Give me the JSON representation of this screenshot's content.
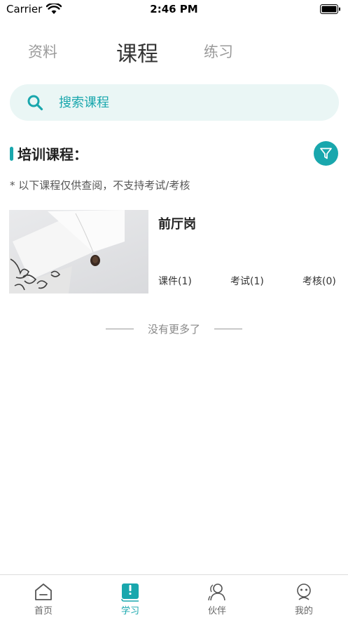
{
  "status_bar": {
    "carrier": "Carrier",
    "time": "2:46 PM"
  },
  "tabs": [
    {
      "label": "资料",
      "active": false
    },
    {
      "label": "课程",
      "active": true
    },
    {
      "label": "练习",
      "active": false
    }
  ],
  "search": {
    "placeholder": "搜索课程",
    "icon": "search-icon"
  },
  "section": {
    "title": "培训课程：",
    "note": "* 以下课程仅供查阅，不支持考试/考核",
    "filter_icon": "filter-icon"
  },
  "courses": [
    {
      "title": "前厅岗",
      "stats": [
        "课件(1)",
        "考试(1)",
        "考核(0)"
      ]
    }
  ],
  "list_end": {
    "text": "没有更多了"
  },
  "bottom_nav": [
    {
      "label": "首页",
      "icon": "home-icon",
      "active": false
    },
    {
      "label": "学习",
      "icon": "book-icon",
      "active": true
    },
    {
      "label": "伙伴",
      "icon": "partners-icon",
      "active": false
    },
    {
      "label": "我的",
      "icon": "profile-icon",
      "active": false
    }
  ],
  "colors": {
    "accent": "#19a7ad",
    "search_bg": "#eaf6f5"
  }
}
